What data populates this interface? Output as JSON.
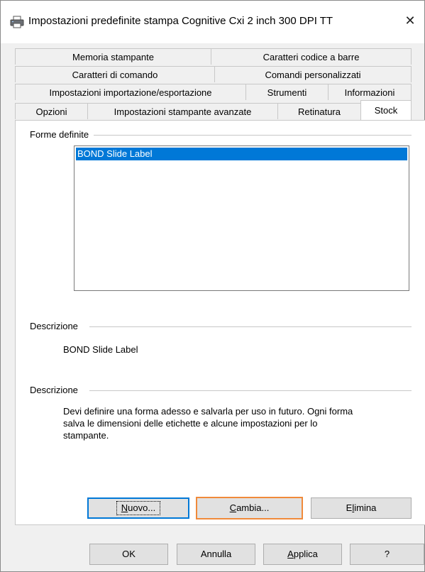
{
  "window": {
    "title": "Impostazioni predefinite stampa Cognitive Cxi 2 inch 300 DPI TT",
    "close_glyph": "✕"
  },
  "tabs": {
    "row1": [
      "Memoria stampante",
      "Caratteri codice a barre"
    ],
    "row2": [
      "Caratteri di comando",
      "Comandi personalizzati"
    ],
    "row3": [
      "Impostazioni importazione/esportazione",
      "Strumenti",
      "Informazioni"
    ],
    "row4": [
      "Opzioni",
      "Impostazioni stampante avanzate",
      "Retinatura",
      "Stock"
    ],
    "active": "Stock"
  },
  "stock": {
    "forms_label": "Forme definite",
    "forms": [
      "BOND Slide Label"
    ],
    "selected_form": "BOND Slide Label",
    "description1_label": "Descrizione",
    "description1_text": "BOND Slide Label",
    "description2_label": "Descrizione",
    "description2_lines": [
      "Devi definire una forma adesso e salvarla per uso in futuro. Ogni forma",
      "salva le dimensioni delle etichette e alcune impostazioni per lo",
      "stampante."
    ],
    "buttons": {
      "new_prefix": "",
      "new_accel": "N",
      "new_rest": "uovo...",
      "change_prefix": "",
      "change_accel": "C",
      "change_rest": "ambia...",
      "delete_prefix": "E",
      "delete_accel": "l",
      "delete_rest": "imina"
    }
  },
  "footer": {
    "ok": "OK",
    "cancel": "Annulla",
    "apply_accel": "A",
    "apply_rest": "pplica",
    "help": "?"
  },
  "icons": {
    "title": "printer-icon",
    "close": "close-icon"
  }
}
